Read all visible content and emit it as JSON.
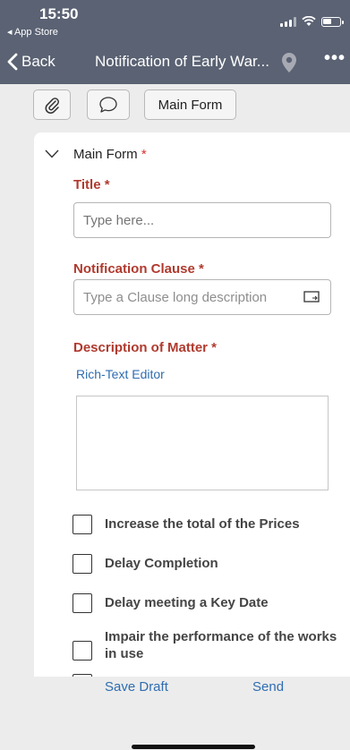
{
  "status_bar": {
    "time": "15:50",
    "back_app": "◂ App Store"
  },
  "nav": {
    "back_label": "Back",
    "title": "Notification of Early War...",
    "more_label": "•••"
  },
  "toolbar": {
    "main_form_tab": "Main Form"
  },
  "form": {
    "section_title": "Main Form",
    "required_mark": "*",
    "title_label": "Title *",
    "title_placeholder": "Type here...",
    "clause_label": "Notification Clause *",
    "clause_placeholder": "Type a Clause long description",
    "description_label": "Description of Matter *",
    "rich_text_link": "Rich-Text Editor",
    "checkboxes": [
      "Increase the total of the Prices",
      "Delay Completion",
      "Delay meeting a Key Date",
      "Impair the performance of the works in use"
    ]
  },
  "bottom": {
    "save_draft": "Save Draft",
    "send": "Send"
  },
  "colors": {
    "header_bg": "#5a6273",
    "label_red": "#b03a2e",
    "link_blue": "#2f6db1",
    "page_bg": "#ececec"
  }
}
